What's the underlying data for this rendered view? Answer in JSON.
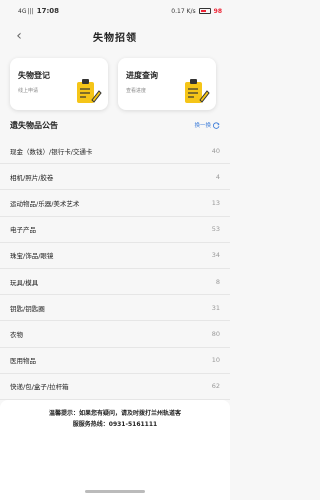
{
  "status_bar": {
    "signal": "4G |||",
    "time": "17:08",
    "network_speed": "0.17 K/s",
    "battery_pct": "98"
  },
  "nav": {
    "title": "失物招领",
    "back_icon": "chevron-left-icon"
  },
  "cards": [
    {
      "title": "失物登记",
      "subtitle": "线上申请",
      "icon": "clipboard-pencil-icon"
    },
    {
      "title": "进度查询",
      "subtitle": "查看进度",
      "icon": "clipboard-pencil-icon"
    }
  ],
  "section": {
    "title": "遗失物品公告",
    "refresh_label": "换一换"
  },
  "items": [
    {
      "label": "现金（数钱）/银行卡/交通卡",
      "count": "40"
    },
    {
      "label": "相机/照片/胶卷",
      "count": "4"
    },
    {
      "label": "运动物品/乐器/美术艺术",
      "count": "13"
    },
    {
      "label": "电子产品",
      "count": "53"
    },
    {
      "label": "珠宝/饰品/眼镜",
      "count": "34"
    },
    {
      "label": "玩具/模具",
      "count": "8"
    },
    {
      "label": "钥匙/钥匙圈",
      "count": "31"
    },
    {
      "label": "衣物",
      "count": "80"
    },
    {
      "label": "医用物品",
      "count": "10"
    },
    {
      "label": "快递/包/盒子/拉杆箱",
      "count": "62"
    }
  ],
  "notice": {
    "line1": "温馨提示：如果您有疑问，请及时拨打兰州轨道客",
    "line2": "服服务热线：0931-5161111"
  },
  "colors": {
    "accent": "#3b7bd8",
    "icon_yellow": "#f5c518",
    "battery_red": "#e23"
  }
}
